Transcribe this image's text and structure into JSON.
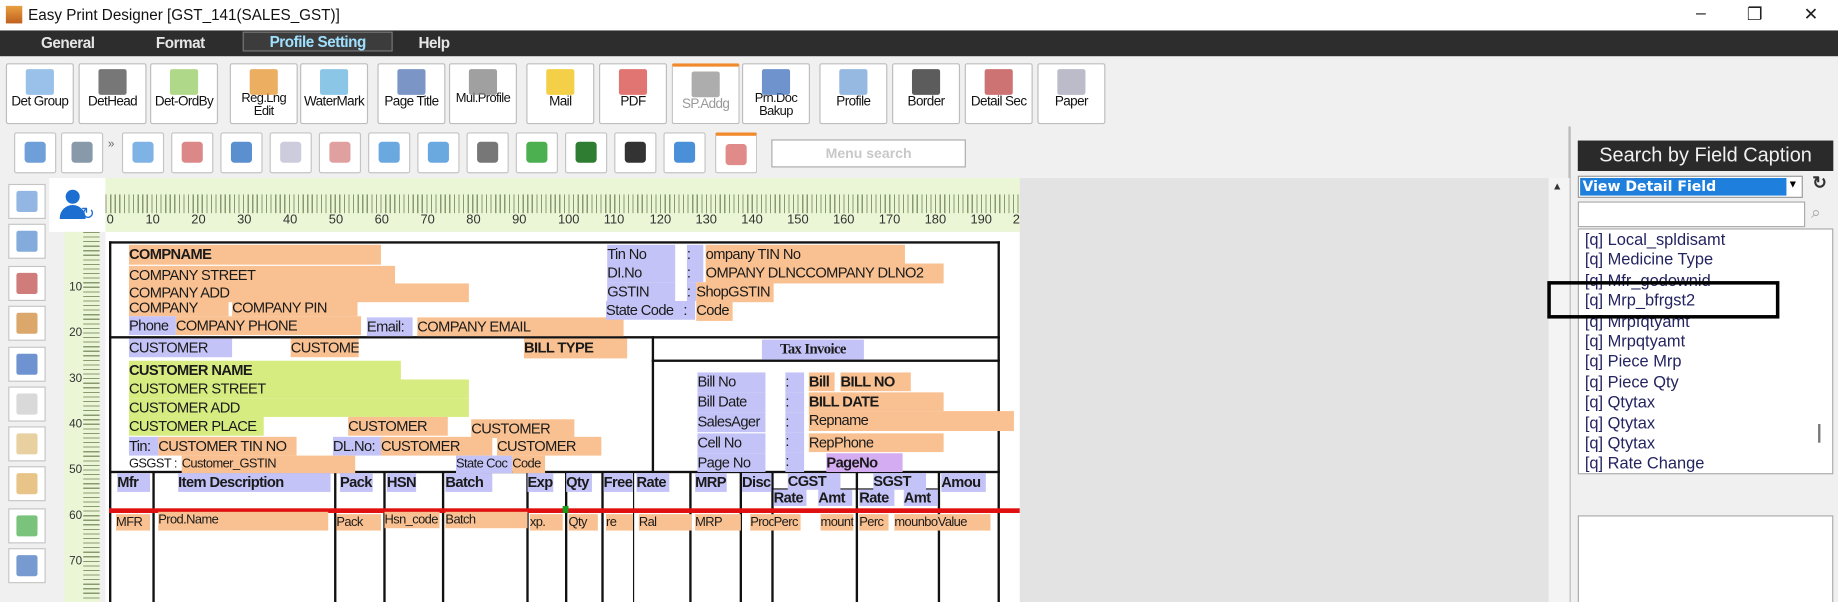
{
  "window": {
    "title": "Easy Print Designer [GST_141(SALES_GST)]",
    "minimize": "–",
    "maximize": "❐",
    "close": "✕"
  },
  "menu": [
    "General",
    "Format",
    "Profile Setting",
    "Help"
  ],
  "toolbar1": [
    {
      "label": "Det Group",
      "icon": "det-group-icon",
      "color": "#7fb2e5"
    },
    {
      "label": "DetHead",
      "icon": "det-head-icon",
      "color": "#555"
    },
    {
      "label": "Det-OrdBy",
      "icon": "order-by-icon",
      "color": "#9bcf6a"
    },
    {
      "label": "Reg.Lng Edit",
      "icon": "edit-pencil-icon",
      "color": "#e79b3b"
    },
    {
      "label": "WaterMark",
      "icon": "watermark-icon",
      "color": "#6fb8e0"
    },
    {
      "label": "Page Title",
      "icon": "page-gear-icon",
      "color": "#5a7cb8"
    },
    {
      "label": "Mul.Profile",
      "icon": "multi-profile-icon",
      "color": "#888"
    },
    {
      "label": "Mail",
      "icon": "mail-gear-icon",
      "color": "#f0c419"
    },
    {
      "label": "PDF",
      "icon": "pdf-gear-icon",
      "color": "#d9534f"
    },
    {
      "label": "SP.Addg",
      "icon": "sp-adding-icon",
      "color": "#999"
    },
    {
      "label": "Prn.Doc Bakup",
      "icon": "doc-backup-icon",
      "color": "#4a78c0"
    },
    {
      "label": "Profile",
      "icon": "profile-icon",
      "color": "#7aa7d8"
    },
    {
      "label": "Border",
      "icon": "border-icon",
      "color": "#333"
    },
    {
      "label": "Detail Sec",
      "icon": "detail-section-icon",
      "color": "#c05050"
    },
    {
      "label": "Paper",
      "icon": "paper-icon",
      "color": "#aab"
    }
  ],
  "toolbar2_icons": [
    "preview-icon",
    "printer-icon",
    "import-icon",
    "delete-field-icon",
    "printer-setup-icon",
    "bottle-icon",
    "insert-icon",
    "cloud-upload-icon",
    "cloud-download-icon",
    "usb-drive-icon",
    "refresh-globe-icon",
    "globe-icon",
    "dot-matrix-printer-icon",
    "print-share-icon",
    "print-active-icon"
  ],
  "menu_search_placeholder": "Menu search",
  "left_tools": [
    "text-tool-icon",
    "layout-icon",
    "line-tool-icon",
    "pencil-icon",
    "dots-grid-icon",
    "page-icon",
    "note-icon",
    "edit-note-icon",
    "image-insert-icon",
    "numbered-list-icon"
  ],
  "ruler": {
    "h": [
      "0",
      "10",
      "20",
      "30",
      "40",
      "50",
      "60",
      "70",
      "80",
      "90",
      "100",
      "110",
      "120",
      "130",
      "140",
      "150",
      "160",
      "170",
      "180",
      "190",
      "2"
    ],
    "v": [
      "10",
      "20",
      "30",
      "40",
      "50",
      "60",
      "70"
    ]
  },
  "doc": {
    "fields": [
      {
        "t": "COMPNAME",
        "c": "o",
        "b": 1
      },
      {
        "t": "COMPANY STREET",
        "c": "o"
      },
      {
        "t": "COMPANY ADD",
        "c": "o"
      },
      {
        "t": "COMPANY",
        "c": "o"
      },
      {
        "t": "COMPANY PIN",
        "c": "o"
      },
      {
        "t": "Phone",
        "c": "b"
      },
      {
        "t": "COMPANY PHONE",
        "c": "o"
      },
      {
        "t": "Email:",
        "c": "b"
      },
      {
        "t": "COMPANY EMAIL",
        "c": "o"
      },
      {
        "t": "Tin No",
        "c": "b"
      },
      {
        "t": "DI.No",
        "c": "b"
      },
      {
        "t": "GSTIN",
        "c": "b"
      },
      {
        "t": "State Code",
        "c": "b"
      },
      {
        "t": ":",
        "c": "b"
      },
      {
        "t": ":",
        "c": "b"
      },
      {
        "t": ":",
        "c": "b"
      },
      {
        "t": ":",
        "c": "b"
      },
      {
        "t": "ompany TIN No",
        "c": "o"
      },
      {
        "t": "OMPANY DLNCCOMPANY DLNO2",
        "c": "o"
      },
      {
        "t": "ShopGSTIN",
        "c": "o"
      },
      {
        "t": "Code",
        "c": "o"
      },
      {
        "t": "CUSTOMER",
        "c": "b"
      },
      {
        "t": "CUSTOME",
        "c": "o"
      },
      {
        "t": "BILL TYPE",
        "c": "o",
        "b": 1
      },
      {
        "t": "Tax Invoice",
        "c": "b",
        "b": 1,
        "serif": 1
      },
      {
        "t": "CUSTOMER NAME",
        "c": "g",
        "b": 1
      },
      {
        "t": "CUSTOMER STREET",
        "c": "g"
      },
      {
        "t": "CUSTOMER ADD",
        "c": "g"
      },
      {
        "t": "CUSTOMER PLACE",
        "c": "g"
      },
      {
        "t": "CUSTOMER",
        "c": "o"
      },
      {
        "t": "CUSTOMER",
        "c": "o"
      },
      {
        "t": "Tin:",
        "c": "b"
      },
      {
        "t": "CUSTOMER TIN NO",
        "c": "o"
      },
      {
        "t": "DL.No:",
        "c": "b"
      },
      {
        "t": "CUSTOMER",
        "c": "o"
      },
      {
        "t": "CUSTOMER",
        "c": "o"
      },
      {
        "t": "GSGST :",
        "c": "n"
      },
      {
        "t": "Customer_GSTIN",
        "c": "o"
      },
      {
        "t": "State Coc",
        "c": "b"
      },
      {
        "t": "Code",
        "c": "o"
      },
      {
        "t": "Bill No",
        "c": "b"
      },
      {
        "t": "Bill Date",
        "c": "b"
      },
      {
        "t": "SalesAger",
        "c": "b"
      },
      {
        "t": "Cell No",
        "c": "b"
      },
      {
        "t": "Page No",
        "c": "b"
      },
      {
        "t": ":",
        "c": "b"
      },
      {
        "t": ":",
        "c": "b"
      },
      {
        "t": ":",
        "c": "b"
      },
      {
        "t": ":",
        "c": "b"
      },
      {
        "t": ":",
        "c": "b"
      },
      {
        "t": "Bill",
        "c": "o",
        "b": 1
      },
      {
        "t": "BILL NO",
        "c": "o",
        "b": 1
      },
      {
        "t": "BILL DATE",
        "c": "o",
        "b": 1
      },
      {
        "t": "Repname",
        "c": "o"
      },
      {
        "t": "RepPhone",
        "c": "o"
      },
      {
        "t": "PageNo",
        "c": "p",
        "b": 1
      },
      {
        "t": "Mfr",
        "c": "b",
        "b": 1
      },
      {
        "t": "Item Description",
        "c": "b",
        "b": 1
      },
      {
        "t": "Pack",
        "c": "b",
        "b": 1
      },
      {
        "t": "HSN",
        "c": "b",
        "b": 1
      },
      {
        "t": "Batch",
        "c": "b",
        "b": 1
      },
      {
        "t": "Exp",
        "c": "b",
        "b": 1
      },
      {
        "t": "Qty",
        "c": "b",
        "b": 1
      },
      {
        "t": "Free",
        "c": "b",
        "b": 1
      },
      {
        "t": "Rate",
        "c": "b",
        "b": 1
      },
      {
        "t": "MRP",
        "c": "b",
        "b": 1
      },
      {
        "t": "Disc",
        "c": "b",
        "b": 1
      },
      {
        "t": "CGST",
        "c": "b",
        "b": 1
      },
      {
        "t": "Rate",
        "c": "b",
        "b": 1
      },
      {
        "t": "Amt",
        "c": "b",
        "b": 1
      },
      {
        "t": "SGST",
        "c": "b",
        "b": 1
      },
      {
        "t": "Rate",
        "c": "b",
        "b": 1
      },
      {
        "t": "Amt",
        "c": "b",
        "b": 1
      },
      {
        "t": "Amou",
        "c": "b",
        "b": 1
      },
      {
        "t": "MFR",
        "c": "o"
      },
      {
        "t": "Prod.Name",
        "c": "o"
      },
      {
        "t": "Pack",
        "c": "o"
      },
      {
        "t": "Hsn_code",
        "c": "o"
      },
      {
        "t": "Batch",
        "c": "o"
      },
      {
        "t": "xp.",
        "c": "o"
      },
      {
        "t": "Qty",
        "c": "o"
      },
      {
        "t": "re",
        "c": "o"
      },
      {
        "t": "Ral",
        "c": "o"
      },
      {
        "t": "MRP",
        "c": "o"
      },
      {
        "t": "Proc",
        "c": "o"
      },
      {
        "t": "Perc",
        "c": "o"
      },
      {
        "t": "mount",
        "c": "o"
      },
      {
        "t": "Perc",
        "c": "o"
      },
      {
        "t": "mounbods",
        "c": "o"
      },
      {
        "t": "Value",
        "c": "o"
      }
    ]
  },
  "right_panel": {
    "title": "Search by Field Caption",
    "dropdown_value": "View Detail Field",
    "search_value": "",
    "items": [
      "[q] Local_spldisamt",
      "[q] Medicine Type",
      "[q] Mfr_godownid",
      "[q] Mrp_bfrgst2",
      "[q] Mrpfqtyamt",
      "[q] Mrpqtyamt",
      "[q] Piece Mrp",
      "[q] Piece Qty",
      "[q] Qtytax",
      "[q] Qtytax",
      "[q] Qtytax",
      "[q] Rate Change"
    ],
    "highlighted_item": "[q] Mrp_bfrgst2"
  }
}
